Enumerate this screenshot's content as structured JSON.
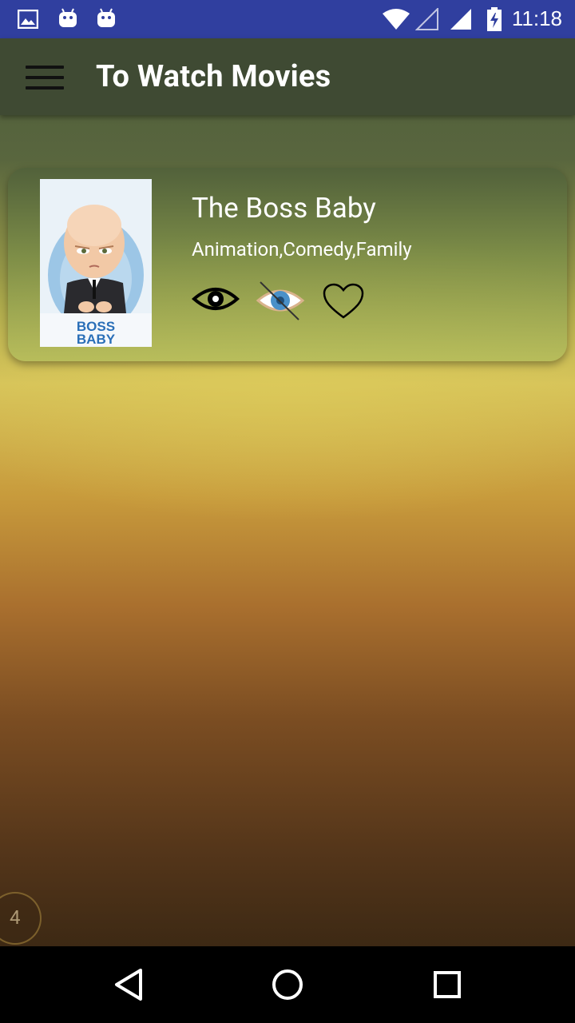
{
  "status_bar": {
    "time": "11:18",
    "icons": [
      "image-notification-icon",
      "android-notification-icon",
      "android-notification-icon",
      "wifi-icon",
      "signal-empty-icon",
      "signal-full-icon",
      "battery-charging-icon"
    ]
  },
  "app_bar": {
    "title": "To Watch Movies",
    "menu_icon": "hamburger-menu-icon"
  },
  "movies": [
    {
      "title": "The Boss Baby",
      "genres": "Animation,Comedy,Family",
      "poster_text": "BOSS BABY",
      "actions": [
        "watched-eye-icon",
        "unwatched-eye-icon",
        "favorite-heart-icon"
      ]
    }
  ],
  "floating_badge": {
    "value": "4"
  },
  "nav_bar": {
    "back": "back-icon",
    "home": "home-icon",
    "recents": "recents-icon"
  },
  "colors": {
    "status_bar": "#303f9f",
    "app_bar": "#3f4a33",
    "unwatched_eye_accent": "#4a90c8"
  }
}
